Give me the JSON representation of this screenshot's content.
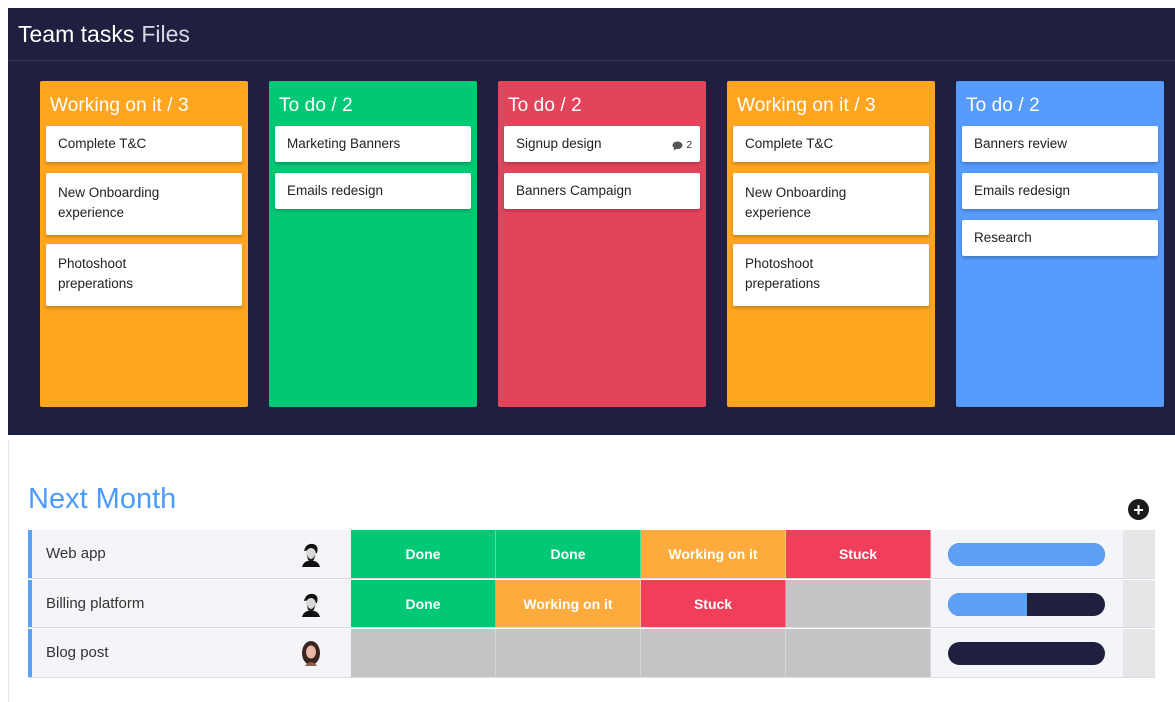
{
  "header": {
    "title": "Team tasks",
    "subtitle": "Files"
  },
  "columns": [
    {
      "title": "Working on it / 3",
      "color": "#ffa51f",
      "cards": [
        {
          "text": "Complete T&C"
        },
        {
          "text": "New Onboarding experience"
        },
        {
          "text": "Photoshoot preperations"
        }
      ]
    },
    {
      "title": "To do / 2",
      "color": "#00c875",
      "cards": [
        {
          "text": "Marketing Banners"
        },
        {
          "text": "Emails redesign"
        }
      ]
    },
    {
      "title": "To do / 2",
      "color": "#e2445c",
      "cards": [
        {
          "text": "Signup design",
          "comments": "2"
        },
        {
          "text": "Banners Campaign"
        }
      ]
    },
    {
      "title": "Working on it / 3",
      "color": "#ffa51f",
      "cards": [
        {
          "text": "Complete T&C"
        },
        {
          "text": "New Onboarding experience"
        },
        {
          "text": "Photoshoot preperations"
        }
      ]
    },
    {
      "title": "To do / 2",
      "color": "#579bfc",
      "cards": [
        {
          "text": "Banners review"
        },
        {
          "text": "Emails redesign"
        },
        {
          "text": "Research"
        }
      ]
    }
  ],
  "group": {
    "title": "Next Month",
    "color": "#4e9bff",
    "add_icon": "plus-circle-icon",
    "rows": [
      {
        "name": "Web app",
        "avatar": "avatar-man-icon",
        "statuses": [
          "Done",
          "Done",
          "Working on it",
          "Stuck",
          ""
        ],
        "progress": 1.0
      },
      {
        "name": "Billing platform",
        "avatar": "avatar-man-icon",
        "statuses": [
          "Done",
          "Working on it",
          "Stuck",
          "",
          ""
        ],
        "progress": 0.5
      },
      {
        "name": "Blog post",
        "avatar": "avatar-woman-icon",
        "statuses": [
          "",
          "",
          "",
          "",
          ""
        ],
        "progress": 0.0
      }
    ]
  },
  "status_colors": {
    "Done": "#00c875",
    "Working on it": "#fdab3d",
    "Stuck": "#f03e5b",
    "empty": "#c4c4c4"
  }
}
